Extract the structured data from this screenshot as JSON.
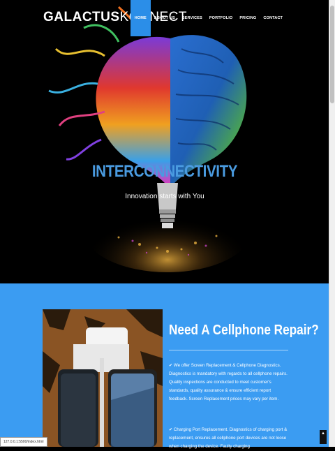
{
  "header": {
    "logo_bold": "GALACTUS",
    "logo_light": "KONNECT",
    "nav": [
      {
        "label": "HOME",
        "active": true
      },
      {
        "label": "ABOUT US",
        "active": false
      },
      {
        "label": "SERVICES",
        "active": false
      },
      {
        "label": "PORTFOLIO",
        "active": false
      },
      {
        "label": "PRICING",
        "active": false
      },
      {
        "label": "CONTACT",
        "active": false
      }
    ]
  },
  "hero": {
    "title": "INTERCONNECTIVITY",
    "subtitle": "Innovation starts with You"
  },
  "repair": {
    "title": "Need A Cellphone Repair?",
    "paragraph1": "✔ We offer Screen Replacement & Cellphone Diagnostics. Diagnostics is mandatory with regards to all cellphone repairs. Quality inspections are conducted to meet customer's standards, quality assurance & ensure efficient report feedback. Screen Replacement prices may vary per item.",
    "paragraph2": "✔ Charging Port Replacement. Diagnostics of charging port & replacement, ensures all cellphone port devices are not loose when charging the device. Faulty charging"
  },
  "status_url": "127.0.0.1:5500/index.html",
  "colors": {
    "accent": "#2b8ee8",
    "section_bg": "#3b9cf2",
    "hero_title": "#4a9be0"
  }
}
